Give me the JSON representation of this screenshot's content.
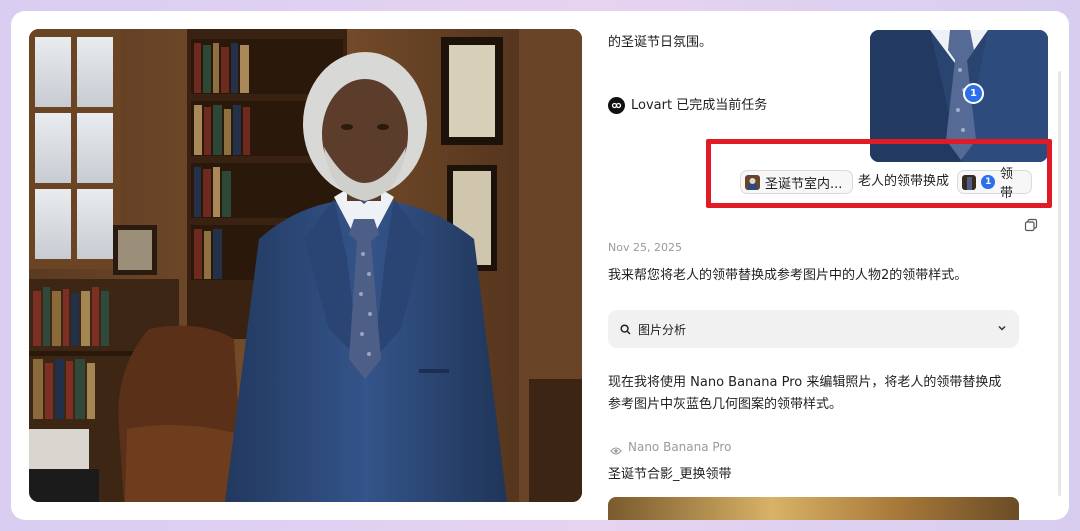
{
  "chat": {
    "top_text": "的圣诞节日氛围。",
    "lovart_status": "Lovart 已完成当前任务",
    "chip_left": "圣诞节室内...",
    "middle_text": "老人的领带换成",
    "chip_right": "领带",
    "chip_right_badge": "1",
    "thumb_badge": "1",
    "date": "Nov 25, 2025",
    "message_1": "我来帮您将老人的领带替换成参考图片中的人物2的领带样式。",
    "analysis_label": "图片分析",
    "message_2_line1": "现在我将使用 Nano Banana Pro 来编辑照片，将老人的领带替换成",
    "message_2_line2": "参考图片中灰蓝色几何图案的领带样式。",
    "model_label": "Nano Banana Pro",
    "result_title": "圣诞节合影_更换领带"
  },
  "colors": {
    "highlight": "#e11b26",
    "badge": "#2c6fe8",
    "suit": "#2d4a7e"
  },
  "icons": {
    "lovart": "lovart-logo-icon",
    "analysis": "search-icon",
    "chevron": "chevron-down-icon",
    "copy": "copy-icon",
    "model": "eye-icon"
  }
}
